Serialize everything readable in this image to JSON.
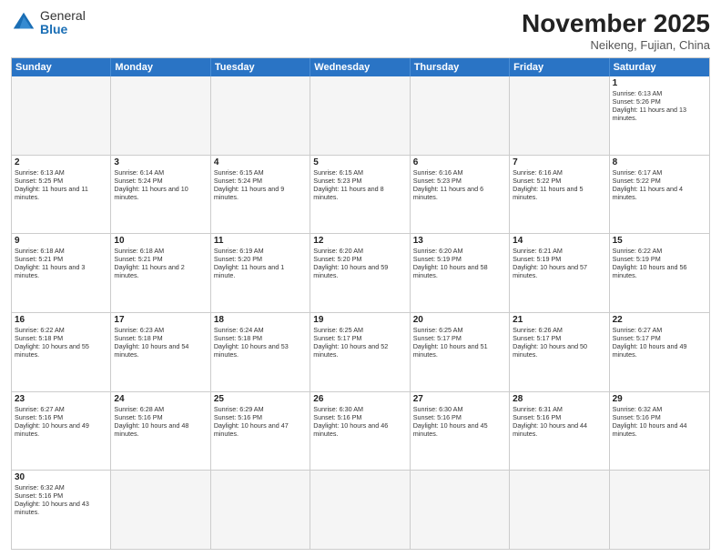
{
  "logo": {
    "general": "General",
    "blue": "Blue"
  },
  "header": {
    "month": "November 2025",
    "location": "Neikeng, Fujian, China"
  },
  "days": [
    "Sunday",
    "Monday",
    "Tuesday",
    "Wednesday",
    "Thursday",
    "Friday",
    "Saturday"
  ],
  "rows": [
    [
      {
        "day": "",
        "empty": true
      },
      {
        "day": "",
        "empty": true
      },
      {
        "day": "",
        "empty": true
      },
      {
        "day": "",
        "empty": true
      },
      {
        "day": "",
        "empty": true
      },
      {
        "day": "",
        "empty": true
      },
      {
        "day": "1",
        "sunrise": "Sunrise: 6:13 AM",
        "sunset": "Sunset: 5:26 PM",
        "daylight": "Daylight: 11 hours and 13 minutes."
      }
    ],
    [
      {
        "day": "2",
        "sunrise": "Sunrise: 6:13 AM",
        "sunset": "Sunset: 5:25 PM",
        "daylight": "Daylight: 11 hours and 11 minutes."
      },
      {
        "day": "3",
        "sunrise": "Sunrise: 6:14 AM",
        "sunset": "Sunset: 5:24 PM",
        "daylight": "Daylight: 11 hours and 10 minutes."
      },
      {
        "day": "4",
        "sunrise": "Sunrise: 6:15 AM",
        "sunset": "Sunset: 5:24 PM",
        "daylight": "Daylight: 11 hours and 9 minutes."
      },
      {
        "day": "5",
        "sunrise": "Sunrise: 6:15 AM",
        "sunset": "Sunset: 5:23 PM",
        "daylight": "Daylight: 11 hours and 8 minutes."
      },
      {
        "day": "6",
        "sunrise": "Sunrise: 6:16 AM",
        "sunset": "Sunset: 5:23 PM",
        "daylight": "Daylight: 11 hours and 6 minutes."
      },
      {
        "day": "7",
        "sunrise": "Sunrise: 6:16 AM",
        "sunset": "Sunset: 5:22 PM",
        "daylight": "Daylight: 11 hours and 5 minutes."
      },
      {
        "day": "8",
        "sunrise": "Sunrise: 6:17 AM",
        "sunset": "Sunset: 5:22 PM",
        "daylight": "Daylight: 11 hours and 4 minutes."
      }
    ],
    [
      {
        "day": "9",
        "sunrise": "Sunrise: 6:18 AM",
        "sunset": "Sunset: 5:21 PM",
        "daylight": "Daylight: 11 hours and 3 minutes."
      },
      {
        "day": "10",
        "sunrise": "Sunrise: 6:18 AM",
        "sunset": "Sunset: 5:21 PM",
        "daylight": "Daylight: 11 hours and 2 minutes."
      },
      {
        "day": "11",
        "sunrise": "Sunrise: 6:19 AM",
        "sunset": "Sunset: 5:20 PM",
        "daylight": "Daylight: 11 hours and 1 minute."
      },
      {
        "day": "12",
        "sunrise": "Sunrise: 6:20 AM",
        "sunset": "Sunset: 5:20 PM",
        "daylight": "Daylight: 10 hours and 59 minutes."
      },
      {
        "day": "13",
        "sunrise": "Sunrise: 6:20 AM",
        "sunset": "Sunset: 5:19 PM",
        "daylight": "Daylight: 10 hours and 58 minutes."
      },
      {
        "day": "14",
        "sunrise": "Sunrise: 6:21 AM",
        "sunset": "Sunset: 5:19 PM",
        "daylight": "Daylight: 10 hours and 57 minutes."
      },
      {
        "day": "15",
        "sunrise": "Sunrise: 6:22 AM",
        "sunset": "Sunset: 5:19 PM",
        "daylight": "Daylight: 10 hours and 56 minutes."
      }
    ],
    [
      {
        "day": "16",
        "sunrise": "Sunrise: 6:22 AM",
        "sunset": "Sunset: 5:18 PM",
        "daylight": "Daylight: 10 hours and 55 minutes."
      },
      {
        "day": "17",
        "sunrise": "Sunrise: 6:23 AM",
        "sunset": "Sunset: 5:18 PM",
        "daylight": "Daylight: 10 hours and 54 minutes."
      },
      {
        "day": "18",
        "sunrise": "Sunrise: 6:24 AM",
        "sunset": "Sunset: 5:18 PM",
        "daylight": "Daylight: 10 hours and 53 minutes."
      },
      {
        "day": "19",
        "sunrise": "Sunrise: 6:25 AM",
        "sunset": "Sunset: 5:17 PM",
        "daylight": "Daylight: 10 hours and 52 minutes."
      },
      {
        "day": "20",
        "sunrise": "Sunrise: 6:25 AM",
        "sunset": "Sunset: 5:17 PM",
        "daylight": "Daylight: 10 hours and 51 minutes."
      },
      {
        "day": "21",
        "sunrise": "Sunrise: 6:26 AM",
        "sunset": "Sunset: 5:17 PM",
        "daylight": "Daylight: 10 hours and 50 minutes."
      },
      {
        "day": "22",
        "sunrise": "Sunrise: 6:27 AM",
        "sunset": "Sunset: 5:17 PM",
        "daylight": "Daylight: 10 hours and 49 minutes."
      }
    ],
    [
      {
        "day": "23",
        "sunrise": "Sunrise: 6:27 AM",
        "sunset": "Sunset: 5:16 PM",
        "daylight": "Daylight: 10 hours and 49 minutes."
      },
      {
        "day": "24",
        "sunrise": "Sunrise: 6:28 AM",
        "sunset": "Sunset: 5:16 PM",
        "daylight": "Daylight: 10 hours and 48 minutes."
      },
      {
        "day": "25",
        "sunrise": "Sunrise: 6:29 AM",
        "sunset": "Sunset: 5:16 PM",
        "daylight": "Daylight: 10 hours and 47 minutes."
      },
      {
        "day": "26",
        "sunrise": "Sunrise: 6:30 AM",
        "sunset": "Sunset: 5:16 PM",
        "daylight": "Daylight: 10 hours and 46 minutes."
      },
      {
        "day": "27",
        "sunrise": "Sunrise: 6:30 AM",
        "sunset": "Sunset: 5:16 PM",
        "daylight": "Daylight: 10 hours and 45 minutes."
      },
      {
        "day": "28",
        "sunrise": "Sunrise: 6:31 AM",
        "sunset": "Sunset: 5:16 PM",
        "daylight": "Daylight: 10 hours and 44 minutes."
      },
      {
        "day": "29",
        "sunrise": "Sunrise: 6:32 AM",
        "sunset": "Sunset: 5:16 PM",
        "daylight": "Daylight: 10 hours and 44 minutes."
      }
    ],
    [
      {
        "day": "30",
        "sunrise": "Sunrise: 6:32 AM",
        "sunset": "Sunset: 5:16 PM",
        "daylight": "Daylight: 10 hours and 43 minutes."
      },
      {
        "day": "",
        "empty": true
      },
      {
        "day": "",
        "empty": true
      },
      {
        "day": "",
        "empty": true
      },
      {
        "day": "",
        "empty": true
      },
      {
        "day": "",
        "empty": true
      },
      {
        "day": "",
        "empty": true
      }
    ]
  ]
}
